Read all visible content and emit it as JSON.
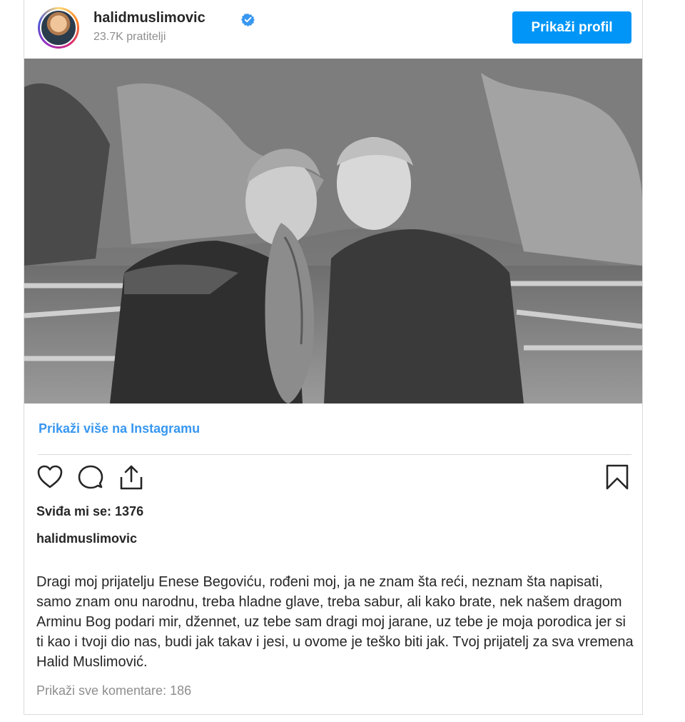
{
  "post": {
    "username": "halidmuslimovic",
    "followers": "23.7K pratitelji",
    "profile_button": "Prikaži profil",
    "more_link": "Prikaži više na Instagramu",
    "likes": "Sviđa mi se: 1376",
    "caption_username": "halidmuslimovic",
    "caption": "Dragi moj prijatelju Enese Begoviću, rođeni moj, ja ne znam šta reći, neznam šta napisati, samo znam onu narodnu, treba hladne glave, treba sabur, ali kako brate, nek našem dragom Arminu Bog podari mir, džennet, uz tebe sam dragi moj jarane, uz tebe je moja porodica jer si ti kao i tvoji dio nas, budi jak takav i jesi, u ovome je teško biti jak. Tvoj prijatelj za sva vremena Halid Muslimović.",
    "comments": "Prikaži sve komentare: 186"
  },
  "icons": [
    "verified-badge-icon",
    "heart-icon",
    "comment-icon",
    "share-icon",
    "bookmark-icon"
  ],
  "colors": {
    "accent": "#0095f6",
    "link": "#3897f0",
    "muted": "#8e8e8e",
    "text": "#262626",
    "border": "#dbdbdb"
  }
}
